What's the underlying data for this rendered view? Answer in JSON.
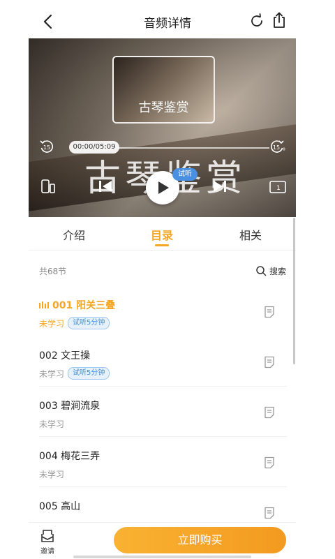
{
  "header": {
    "title": "音频详情"
  },
  "player": {
    "cover_title": "古琴鉴赏",
    "background_title": "古琴鉴赏",
    "time_display": "00:00/05:09",
    "progress": 0.0,
    "trial_badge": "试听",
    "rewind_label": "15",
    "forward_label": "15"
  },
  "tabs": [
    {
      "label": "介绍",
      "active": false
    },
    {
      "label": "目录",
      "active": true
    },
    {
      "label": "相关",
      "active": false
    }
  ],
  "catalog": {
    "count_label": "共68节",
    "search_label": "搜索",
    "items": [
      {
        "title": "001 阳关三叠",
        "status": "未学习",
        "trial": "试听5分钟",
        "playing": true
      },
      {
        "title": "002 文王操",
        "status": "未学习",
        "trial": "试听5分钟",
        "playing": false
      },
      {
        "title": "003 碧涧流泉",
        "status": "未学习",
        "trial": "",
        "playing": false
      },
      {
        "title": "004 梅花三弄",
        "status": "未学习",
        "trial": "",
        "playing": false
      },
      {
        "title": "005 高山",
        "status": "",
        "trial": "",
        "playing": false
      }
    ]
  },
  "bottom": {
    "invite_label": "邀请",
    "buy_label": "立即购买"
  },
  "colors": {
    "accent": "#f5a623",
    "trial_blue": "#3b8ee0",
    "button": "#f39a1f"
  }
}
